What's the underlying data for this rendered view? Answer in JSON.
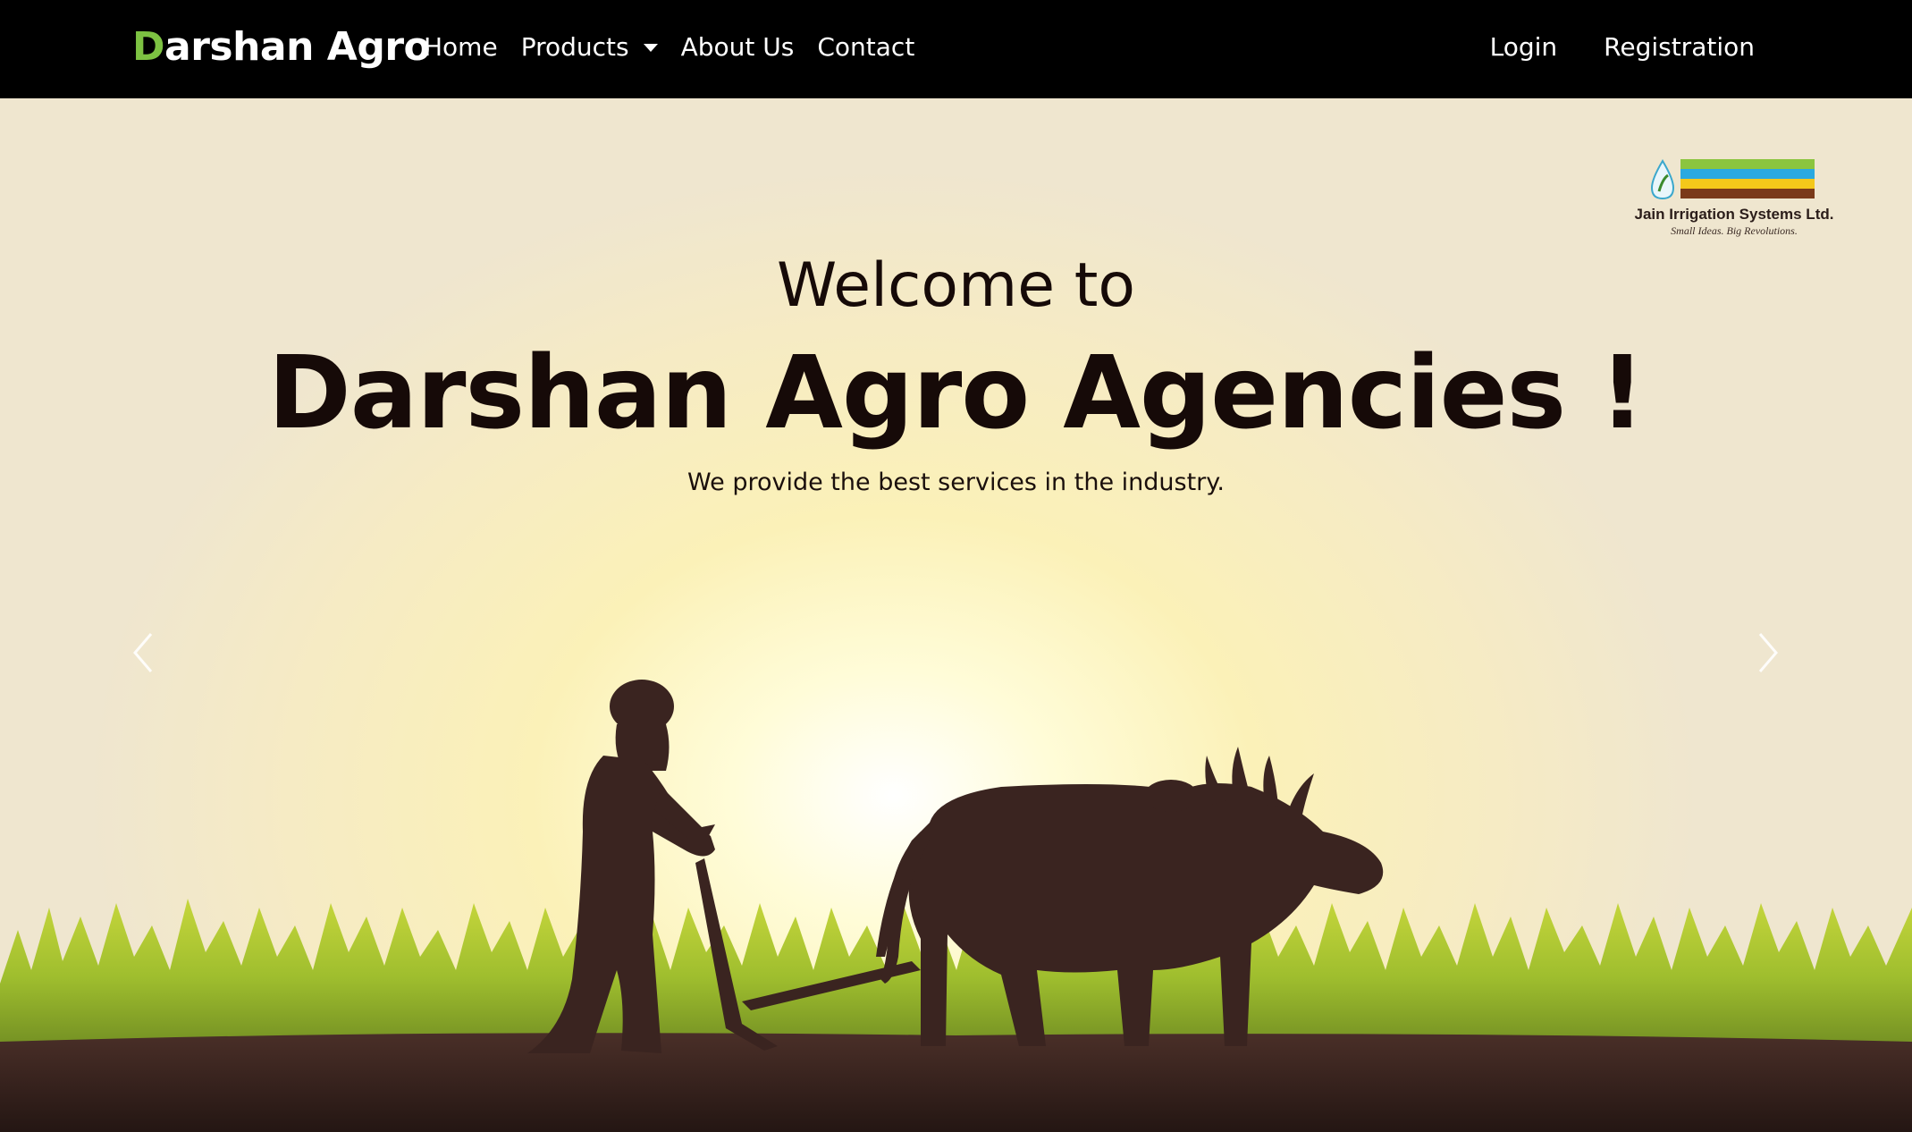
{
  "brand": {
    "first_letter": "D",
    "rest": "arshan Agro"
  },
  "nav": {
    "home": "Home",
    "products": "Products",
    "about": "About Us",
    "contact": "Contact",
    "login": "Login",
    "registration": "Registration"
  },
  "hero": {
    "welcome": "Welcome to",
    "headline": "Darshan Agro Agencies !",
    "tagline": "We provide the best services in the industry."
  },
  "logo": {
    "wordmark": "JAIN",
    "company": "Jain Irrigation Systems Ltd.",
    "slogan": "Small Ideas. Big Revolutions."
  },
  "icons": {
    "prev": "chevron-left-icon",
    "next": "chevron-right-icon",
    "dropdown": "caret-down-icon"
  },
  "colors": {
    "nav_bg": "#000000",
    "brand_accent": "#7dc242",
    "headline": "#160a08",
    "silhouette": "#3a2420",
    "grass": "#a7c633",
    "soil": "#2b1a16"
  }
}
